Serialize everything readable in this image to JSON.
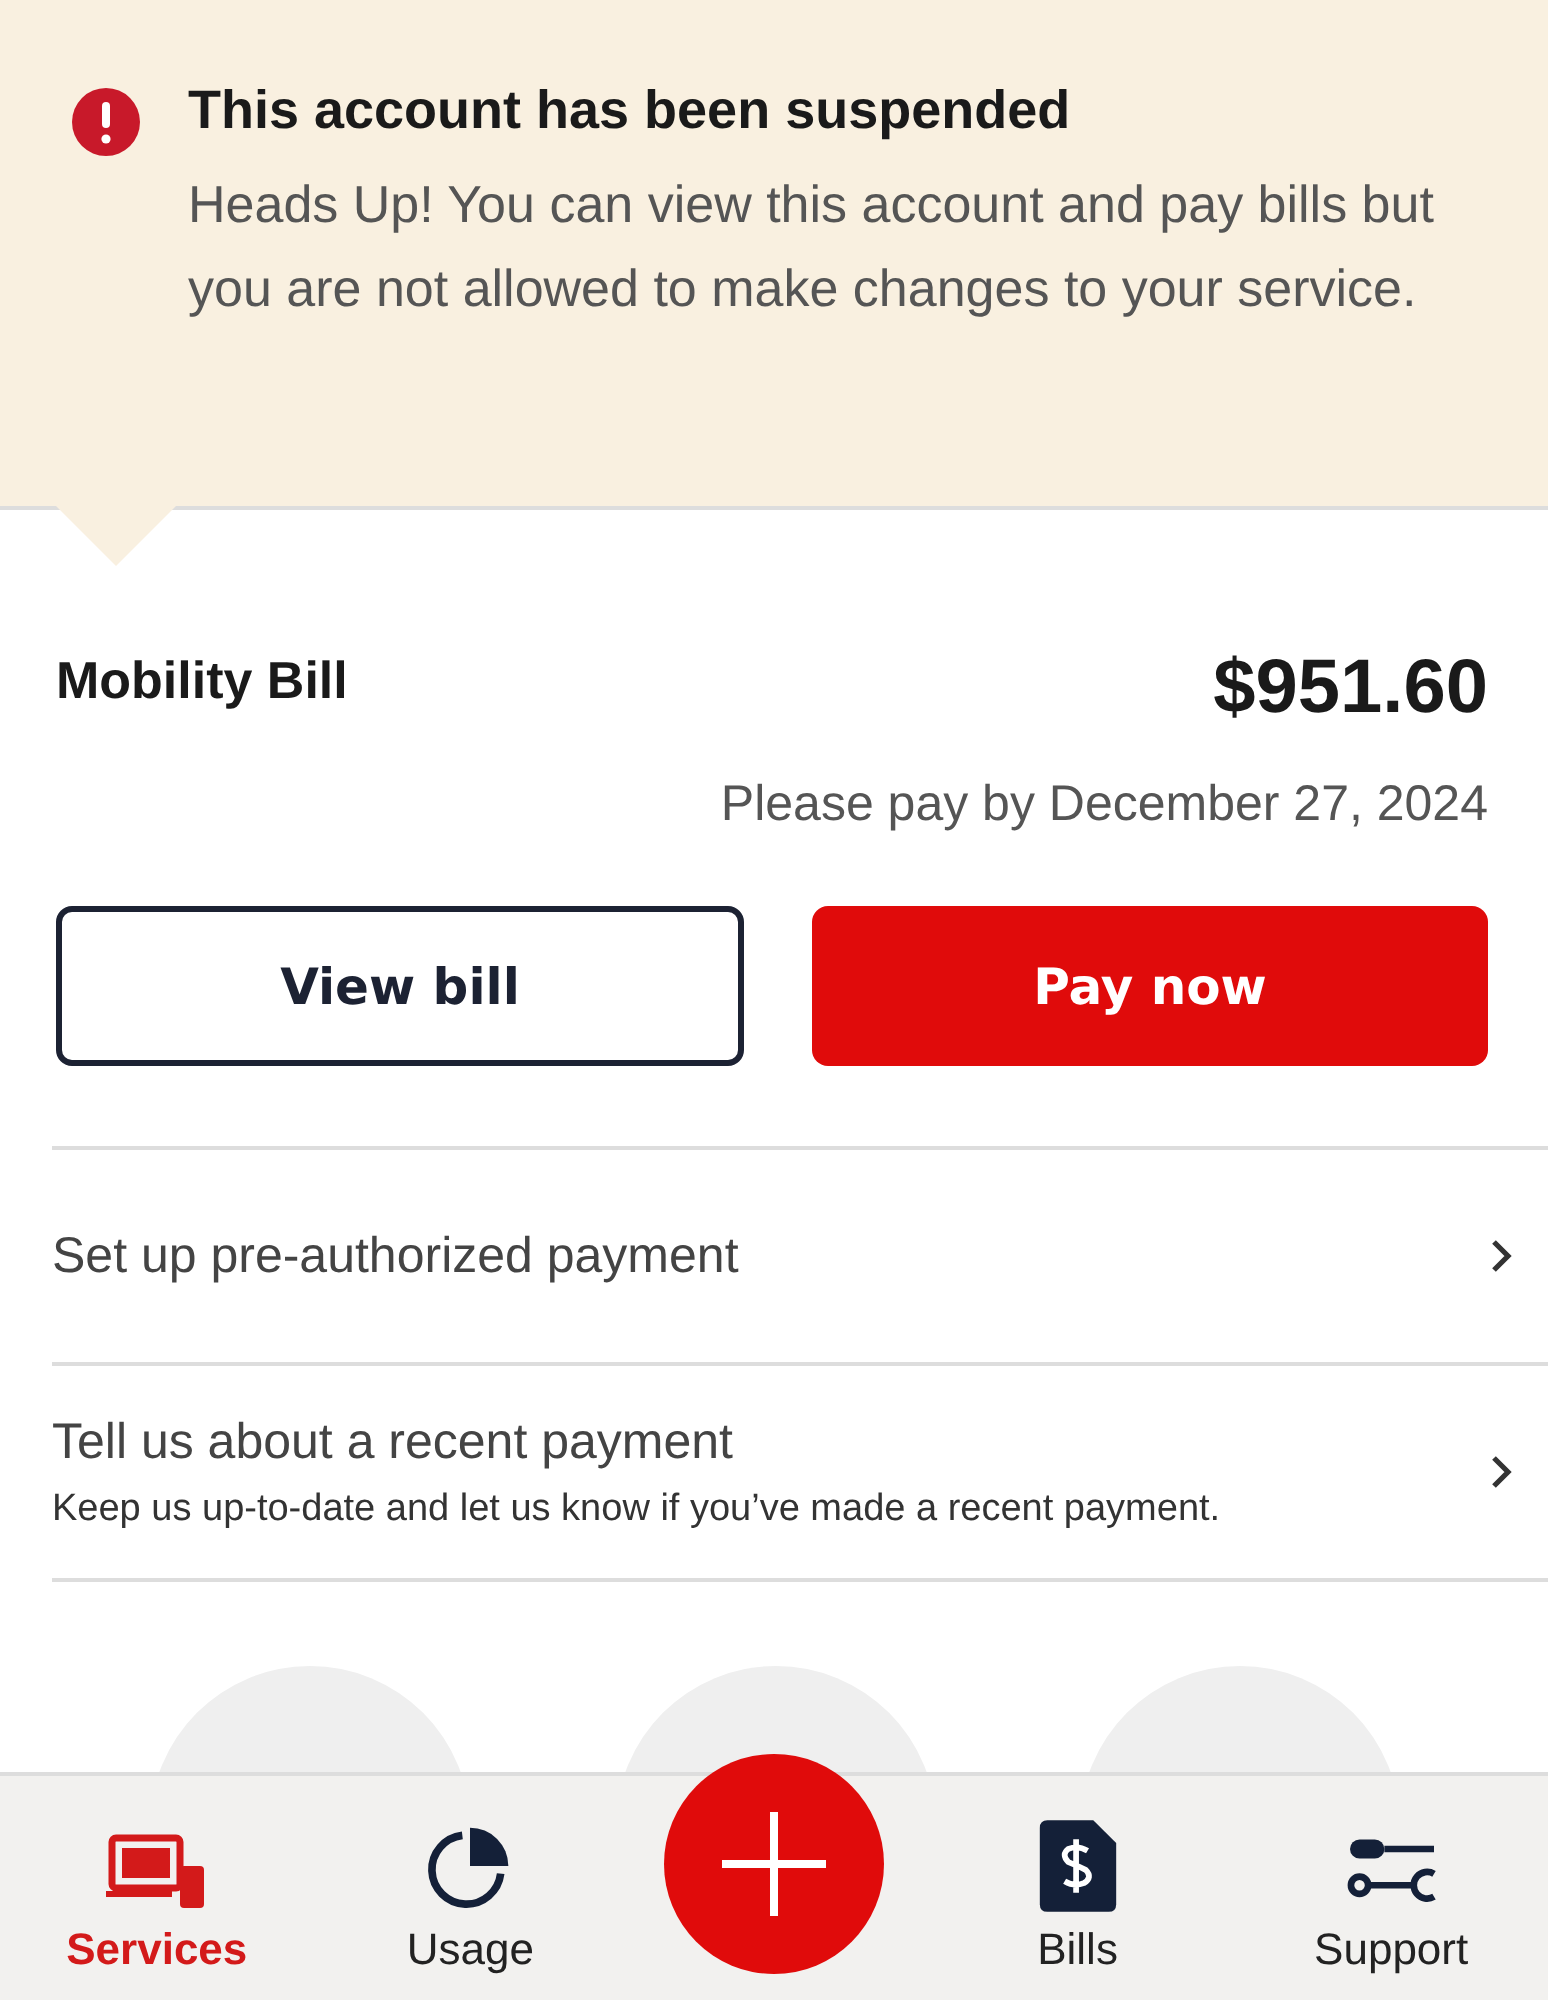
{
  "alert": {
    "title": "This account has been suspended",
    "message": "Heads Up! You can view this account and pay bills but you are not allowed to make changes to your service."
  },
  "bill": {
    "title": "Mobility Bill",
    "amount": "$951.60",
    "due": "Please pay by December 27, 2024"
  },
  "buttons": [
    {
      "label": "View bill",
      "kind": "outline"
    },
    {
      "label": "Pay now",
      "kind": "primary"
    }
  ],
  "rows": [
    {
      "title": "Set up pre-authorized payment"
    },
    {
      "title": "Tell us about a recent payment",
      "subtitle": "Keep us up-to-date and let us know if you’ve made a recent payment."
    }
  ],
  "nav": [
    {
      "label": "Services",
      "kind": "services",
      "selected": true
    },
    {
      "label": "Usage",
      "kind": "usage",
      "selected": false
    },
    {
      "kind": "add"
    },
    {
      "label": "Bills",
      "kind": "bills",
      "selected": false
    },
    {
      "label": "Support",
      "kind": "support",
      "selected": false
    }
  ]
}
